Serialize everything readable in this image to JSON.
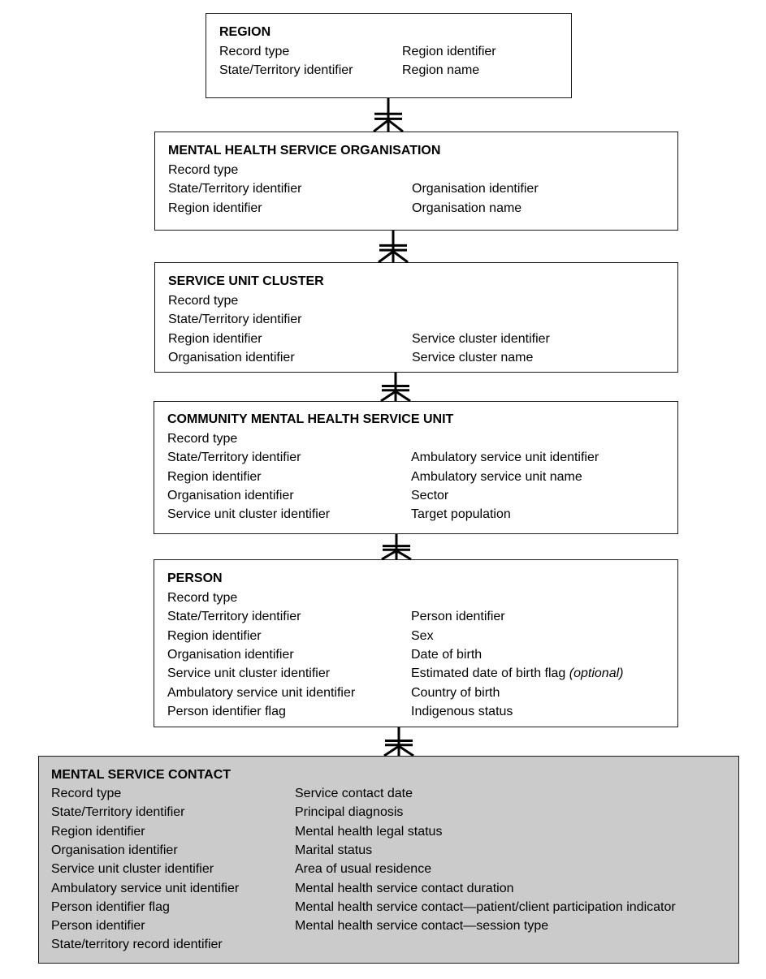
{
  "diagram": {
    "type": "entity-relationship",
    "relationship_notation": "crow's foot (one-to-many, mandatory)",
    "entities": [
      {
        "id": "region",
        "title": "REGION",
        "col1": [
          "Record type",
          "State/Territory identifier"
        ],
        "col2": [
          "Region identifier",
          "Region name"
        ]
      },
      {
        "id": "organisation",
        "title": "MENTAL HEALTH SERVICE ORGANISATION",
        "col1": [
          "Record type",
          "State/Territory identifier",
          "Region identifier"
        ],
        "col2": [
          "",
          "Organisation identifier",
          "Organisation name"
        ]
      },
      {
        "id": "cluster",
        "title": "SERVICE UNIT CLUSTER",
        "col1": [
          "Record type",
          "State/Territory identifier",
          "Region identifier",
          "Organisation identifier"
        ],
        "col2": [
          "",
          "",
          "Service cluster identifier",
          "Service cluster name"
        ]
      },
      {
        "id": "unit",
        "title": "COMMUNITY MENTAL HEALTH SERVICE UNIT",
        "col1": [
          "Record type",
          "State/Territory identifier",
          "Region identifier",
          "Organisation identifier",
          "Service unit cluster identifier"
        ],
        "col2": [
          "",
          "Ambulatory service unit identifier",
          "Ambulatory service unit name",
          "Sector",
          "Target population"
        ]
      },
      {
        "id": "person",
        "title": "PERSON",
        "col1": [
          "Record type",
          "State/Territory identifier",
          "Region identifier",
          "Organisation identifier",
          "Service unit cluster identifier",
          "Ambulatory service unit identifier",
          "Person identifier flag"
        ],
        "col2": [
          "",
          "Person identifier",
          "Sex",
          "Date of birth",
          "Estimated date of birth flag",
          "Country of birth",
          "Indigenous status"
        ],
        "col2_notes": {
          "4": "(optional)"
        }
      },
      {
        "id": "contact",
        "title": "MENTAL SERVICE CONTACT",
        "col1": [
          "Record type",
          "State/Territory identifier",
          "Region identifier",
          "Organisation identifier",
          "Service unit cluster identifier",
          "Ambulatory service unit identifier",
          "Person identifier flag",
          "Person identifier",
          "State/territory record identifier"
        ],
        "col2": [
          "Service contact date",
          "Principal diagnosis",
          "Mental health legal status",
          "Marital status",
          "Area of usual residence",
          "Mental health service contact duration",
          "Mental health service contact—patient/client participation indicator",
          "Mental health service contact—session type"
        ]
      }
    ],
    "relationships": [
      {
        "from": "region",
        "to": "organisation",
        "cardinality": "one-to-many"
      },
      {
        "from": "organisation",
        "to": "cluster",
        "cardinality": "one-to-many"
      },
      {
        "from": "cluster",
        "to": "unit",
        "cardinality": "one-to-many"
      },
      {
        "from": "unit",
        "to": "person",
        "cardinality": "one-to-many"
      },
      {
        "from": "person",
        "to": "contact",
        "cardinality": "one-to-many"
      }
    ],
    "colors": {
      "border": "#1a1a1a",
      "shaded_fill": "#cbcbcb",
      "text": "#000000"
    }
  }
}
